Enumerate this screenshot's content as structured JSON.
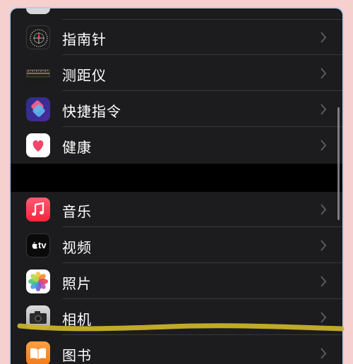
{
  "settings_list": {
    "items": [
      {
        "key": "compass",
        "label": "指南针",
        "icon": "compass-icon"
      },
      {
        "key": "measure",
        "label": "测距仪",
        "icon": "measure-icon"
      },
      {
        "key": "shortcuts",
        "label": "快捷指令",
        "icon": "shortcuts-icon"
      },
      {
        "key": "health",
        "label": "健康",
        "icon": "health-icon"
      },
      {
        "key": "music",
        "label": "音乐",
        "icon": "music-icon"
      },
      {
        "key": "tv",
        "label": "视频",
        "icon": "apple-tv-icon"
      },
      {
        "key": "photos",
        "label": "照片",
        "icon": "photos-icon"
      },
      {
        "key": "camera",
        "label": "相机",
        "icon": "camera-icon"
      },
      {
        "key": "books",
        "label": "图书",
        "icon": "books-icon"
      }
    ],
    "tv_icon_text": "tv"
  },
  "colors": {
    "page_background": "#f6cfcf",
    "row_background": "#1c1c1e",
    "separator": "#38383a",
    "label": "#ffffff",
    "chevron": "#5a5a5e",
    "highlight_stroke": "#c9b22a"
  }
}
